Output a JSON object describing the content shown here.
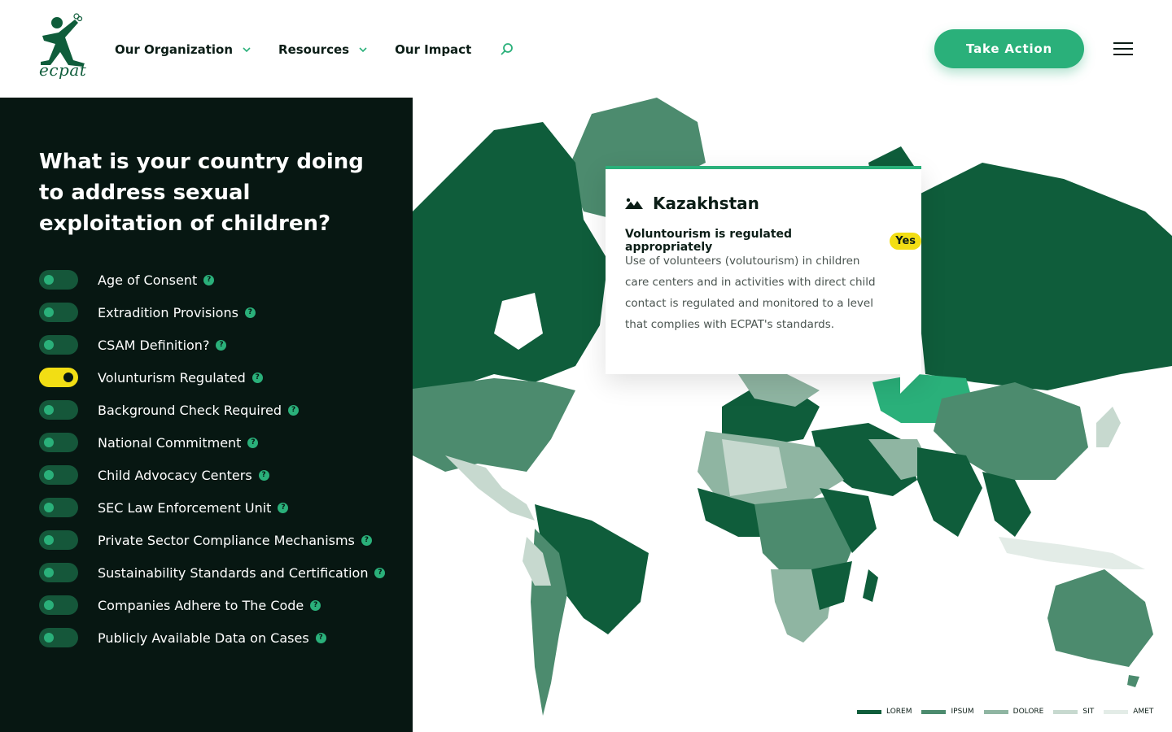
{
  "brand": {
    "logo_text": "ecpat",
    "accent": "#2ab07a",
    "dark": "#071712",
    "highlight": "#f2de14"
  },
  "nav": {
    "items": [
      {
        "label": "Our Organization",
        "dropdown": true
      },
      {
        "label": "Resources",
        "dropdown": true
      },
      {
        "label": "Our Impact",
        "dropdown": false
      }
    ],
    "search_icon": "search-icon",
    "cta_label": "Take Action",
    "menu_icon": "hamburger-menu-icon"
  },
  "sidebar": {
    "title": "What is your country doing to address sexual exploitation of children?",
    "toggles": [
      {
        "label": "Age of Consent",
        "on": false
      },
      {
        "label": "Extradition Provisions",
        "on": false
      },
      {
        "label": "CSAM Definition?",
        "on": false
      },
      {
        "label": "Volunturism Regulated",
        "on": true
      },
      {
        "label": "Background Check Required",
        "on": false
      },
      {
        "label": "National Commitment",
        "on": false
      },
      {
        "label": "Child Advocacy Centers",
        "on": false
      },
      {
        "label": "SEC Law Enforcement Unit",
        "on": false
      },
      {
        "label": "Private Sector Compliance Mechanisms",
        "on": false
      },
      {
        "label": "Sustainability Standards and Certification",
        "on": false
      },
      {
        "label": "Companies Adhere to The Code",
        "on": false
      },
      {
        "label": "Publicly Available Data on Cases",
        "on": false
      }
    ],
    "help_glyph": "?"
  },
  "popup": {
    "country": "Kazakhstan",
    "question": "Voluntourism is regulated appropriately",
    "answer": "Yes",
    "description": "Use of volunteers (volutourism) in children care centers and in activities with direct child contact is regulated and monitored to a level that complies with ECPAT's standards."
  },
  "legend": [
    {
      "label": "LOREM",
      "color": "#0f5d3b"
    },
    {
      "label": "IPSUM",
      "color": "#4c8b6e"
    },
    {
      "label": "DOLORE",
      "color": "#8fb5a2"
    },
    {
      "label": "SIT",
      "color": "#c7d9cf"
    },
    {
      "label": "AMET",
      "color": "#e3ece7"
    }
  ]
}
